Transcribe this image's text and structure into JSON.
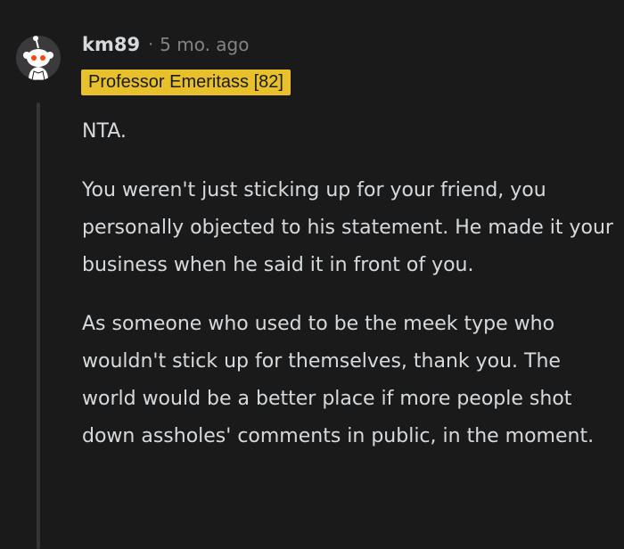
{
  "comment": {
    "username": "km89",
    "separator": "·",
    "timestamp": "5 mo. ago",
    "flair": "Professor Emeritass [82]",
    "avatar_icon": "reddit-snoo-avatar-icon",
    "paragraphs": [
      "NTA.",
      "You weren't just sticking up for your friend, you personally objected to his statement. He made it your business when he said it in front of you.",
      "As someone who used to be the meek type who wouldn't stick up for themselves, thank you. The world would be a better place if more people shot down assholes' comments in public, in the moment."
    ]
  },
  "colors": {
    "background": "#1a1a1b",
    "text": "#d7dadc",
    "muted": "#818384",
    "flair_bg": "#e8c02c",
    "thread_line": "#343536"
  }
}
